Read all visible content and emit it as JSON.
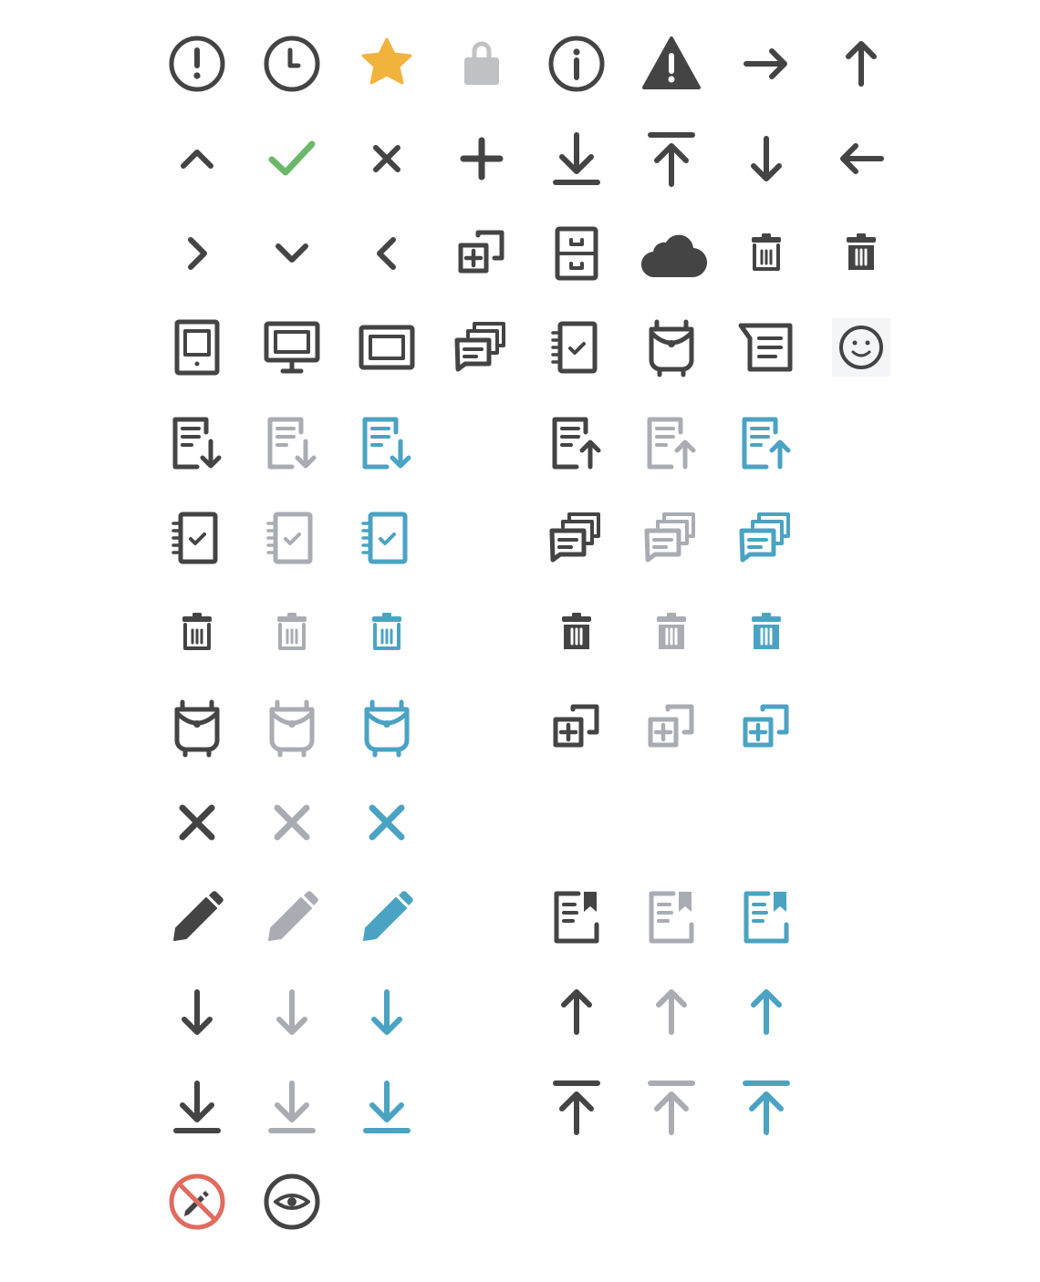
{
  "colors": {
    "dark": "#444444",
    "gray": "#a9adb3",
    "blue": "#4aa3c3",
    "star": "#f2b33d",
    "check": "#6cb86a",
    "lock": "#c0c1c4",
    "prohibit": "#e06b5f"
  },
  "icons": [
    {
      "name": "exclamation-circle-icon",
      "color": "dark",
      "row": 0,
      "col": 0
    },
    {
      "name": "clock-icon",
      "color": "dark",
      "row": 0,
      "col": 1
    },
    {
      "name": "star-icon",
      "color": "star",
      "row": 0,
      "col": 2
    },
    {
      "name": "lock-icon",
      "color": "lock",
      "row": 0,
      "col": 3
    },
    {
      "name": "info-circle-icon",
      "color": "dark",
      "row": 0,
      "col": 4
    },
    {
      "name": "warning-icon",
      "color": "dark",
      "row": 0,
      "col": 5
    },
    {
      "name": "arrow-right-icon",
      "color": "dark",
      "row": 0,
      "col": 6
    },
    {
      "name": "arrow-up-icon",
      "color": "dark",
      "row": 0,
      "col": 7
    },
    {
      "name": "chevron-up-icon",
      "color": "dark",
      "row": 1,
      "col": 0
    },
    {
      "name": "check-icon",
      "color": "check",
      "row": 1,
      "col": 1
    },
    {
      "name": "close-small-icon",
      "color": "dark",
      "row": 1,
      "col": 2
    },
    {
      "name": "plus-icon",
      "color": "dark",
      "row": 1,
      "col": 3
    },
    {
      "name": "download-icon",
      "color": "dark",
      "row": 1,
      "col": 4
    },
    {
      "name": "upload-top-icon",
      "color": "dark",
      "row": 1,
      "col": 5
    },
    {
      "name": "arrow-down-icon",
      "color": "dark",
      "row": 1,
      "col": 6
    },
    {
      "name": "arrow-left-icon",
      "color": "dark",
      "row": 1,
      "col": 7
    },
    {
      "name": "chevron-right-icon",
      "color": "dark",
      "row": 2,
      "col": 0
    },
    {
      "name": "chevron-down-icon",
      "color": "dark",
      "row": 2,
      "col": 1
    },
    {
      "name": "chevron-left-icon",
      "color": "dark",
      "row": 2,
      "col": 2
    },
    {
      "name": "duplicate-add-icon",
      "color": "dark",
      "row": 2,
      "col": 3
    },
    {
      "name": "file-cabinet-icon",
      "color": "dark",
      "row": 2,
      "col": 4
    },
    {
      "name": "cloud-icon",
      "color": "dark",
      "row": 2,
      "col": 5
    },
    {
      "name": "trash-outline-icon",
      "color": "dark",
      "row": 2,
      "col": 6
    },
    {
      "name": "trash-filled-icon",
      "color": "dark",
      "row": 2,
      "col": 7
    },
    {
      "name": "tablet-icon",
      "color": "dark",
      "row": 3,
      "col": 0
    },
    {
      "name": "monitor-icon",
      "color": "dark",
      "row": 3,
      "col": 1
    },
    {
      "name": "frame-icon",
      "color": "dark",
      "row": 3,
      "col": 2
    },
    {
      "name": "chat-stack-icon",
      "color": "dark",
      "row": 3,
      "col": 3
    },
    {
      "name": "notebook-check-icon",
      "color": "dark",
      "row": 3,
      "col": 4
    },
    {
      "name": "backpack-icon",
      "color": "dark",
      "row": 3,
      "col": 5
    },
    {
      "name": "note-icon",
      "color": "dark",
      "row": 3,
      "col": 6
    },
    {
      "name": "smiley-icon",
      "color": "dark",
      "row": 3,
      "col": 7
    },
    {
      "name": "doc-download-icon",
      "color": "dark",
      "row": 4,
      "col": 0
    },
    {
      "name": "doc-download-icon",
      "color": "gray",
      "row": 4,
      "col": 1
    },
    {
      "name": "doc-download-icon",
      "color": "blue",
      "row": 4,
      "col": 2
    },
    {
      "name": "doc-upload-icon",
      "color": "dark",
      "row": 4,
      "col": 4
    },
    {
      "name": "doc-upload-icon",
      "color": "gray",
      "row": 4,
      "col": 5
    },
    {
      "name": "doc-upload-icon",
      "color": "blue",
      "row": 4,
      "col": 6
    },
    {
      "name": "notebook-check-icon",
      "color": "dark",
      "row": 5,
      "col": 0
    },
    {
      "name": "notebook-check-icon",
      "color": "gray",
      "row": 5,
      "col": 1
    },
    {
      "name": "notebook-check-icon",
      "color": "blue",
      "row": 5,
      "col": 2
    },
    {
      "name": "chat-stack-icon",
      "color": "dark",
      "row": 5,
      "col": 4
    },
    {
      "name": "chat-stack-icon",
      "color": "gray",
      "row": 5,
      "col": 5
    },
    {
      "name": "chat-stack-icon",
      "color": "blue",
      "row": 5,
      "col": 6
    },
    {
      "name": "trash-outline-icon",
      "color": "dark",
      "row": 6,
      "col": 0
    },
    {
      "name": "trash-outline-icon",
      "color": "gray",
      "row": 6,
      "col": 1
    },
    {
      "name": "trash-outline-icon",
      "color": "blue",
      "row": 6,
      "col": 2
    },
    {
      "name": "trash-filled-icon",
      "color": "dark",
      "row": 6,
      "col": 4
    },
    {
      "name": "trash-filled-icon",
      "color": "gray",
      "row": 6,
      "col": 5
    },
    {
      "name": "trash-filled-icon",
      "color": "blue",
      "row": 6,
      "col": 6
    },
    {
      "name": "backpack-icon",
      "color": "dark",
      "row": 7,
      "col": 0
    },
    {
      "name": "backpack-icon",
      "color": "gray",
      "row": 7,
      "col": 1
    },
    {
      "name": "backpack-icon",
      "color": "blue",
      "row": 7,
      "col": 2
    },
    {
      "name": "duplicate-add-icon",
      "color": "dark",
      "row": 7,
      "col": 4
    },
    {
      "name": "duplicate-add-icon",
      "color": "gray",
      "row": 7,
      "col": 5
    },
    {
      "name": "duplicate-add-icon",
      "color": "blue",
      "row": 7,
      "col": 6
    },
    {
      "name": "close-icon",
      "color": "dark",
      "row": 8,
      "col": 0
    },
    {
      "name": "close-icon",
      "color": "gray",
      "row": 8,
      "col": 1
    },
    {
      "name": "close-icon",
      "color": "blue",
      "row": 8,
      "col": 2
    },
    {
      "name": "pencil-icon",
      "color": "dark",
      "row": 9,
      "col": 0
    },
    {
      "name": "pencil-icon",
      "color": "gray",
      "row": 9,
      "col": 1
    },
    {
      "name": "pencil-icon",
      "color": "blue",
      "row": 9,
      "col": 2
    },
    {
      "name": "bookmark-doc-icon",
      "color": "dark",
      "row": 9,
      "col": 4
    },
    {
      "name": "bookmark-doc-icon",
      "color": "gray",
      "row": 9,
      "col": 5
    },
    {
      "name": "bookmark-doc-icon",
      "color": "blue",
      "row": 9,
      "col": 6
    },
    {
      "name": "arrow-down-icon",
      "color": "dark",
      "row": 10,
      "col": 0
    },
    {
      "name": "arrow-down-icon",
      "color": "gray",
      "row": 10,
      "col": 1
    },
    {
      "name": "arrow-down-icon",
      "color": "blue",
      "row": 10,
      "col": 2
    },
    {
      "name": "arrow-up-icon",
      "color": "dark",
      "row": 10,
      "col": 4
    },
    {
      "name": "arrow-up-icon",
      "color": "gray",
      "row": 10,
      "col": 5
    },
    {
      "name": "arrow-up-icon",
      "color": "blue",
      "row": 10,
      "col": 6
    },
    {
      "name": "download-icon",
      "color": "dark",
      "row": 11,
      "col": 0
    },
    {
      "name": "download-icon",
      "color": "gray",
      "row": 11,
      "col": 1
    },
    {
      "name": "download-icon",
      "color": "blue",
      "row": 11,
      "col": 2
    },
    {
      "name": "upload-top-icon",
      "color": "dark",
      "row": 11,
      "col": 4
    },
    {
      "name": "upload-top-icon",
      "color": "gray",
      "row": 11,
      "col": 5
    },
    {
      "name": "upload-top-icon",
      "color": "blue",
      "row": 11,
      "col": 6
    },
    {
      "name": "no-edit-icon",
      "color": "prohibit",
      "row": 12,
      "col": 0
    },
    {
      "name": "eye-circle-icon",
      "color": "dark",
      "row": 12,
      "col": 1
    }
  ]
}
